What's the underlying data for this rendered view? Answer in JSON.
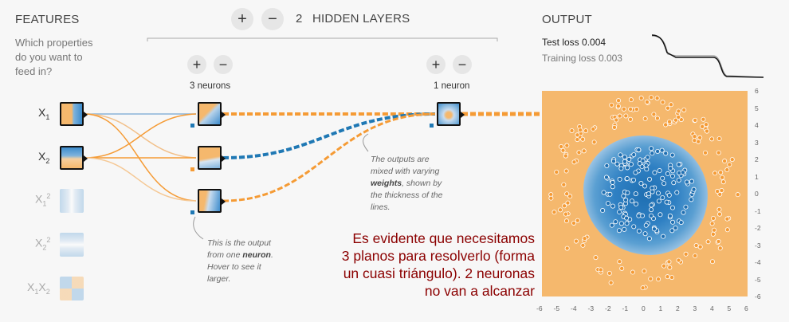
{
  "features": {
    "title": "FEATURES",
    "question": [
      "Which properties",
      "do you want to",
      "feed in?"
    ]
  },
  "hidden": {
    "plus": "+",
    "minus": "−",
    "count": "2",
    "title": "HIDDEN LAYERS",
    "layer1_label": "3 neurons",
    "layer2_label": "1 neuron"
  },
  "output": {
    "title": "OUTPUT",
    "test_loss_label": "Test loss",
    "test_loss_value": "0.004",
    "training_loss_label": "Training loss",
    "training_loss_value": "0.003"
  },
  "notes": {
    "weights_pre": "The outputs are mixed with varying",
    "weights_bold": "weights",
    "weights_post": ", shown by the thickness of the lines.",
    "neuron_pre": "This is the output from one",
    "neuron_bold": "neuron",
    "neuron_post": ". Hover to see it larger."
  },
  "annotation": [
    "Es evidente que necesitamos",
    "3 planos para resolverlo (forma",
    "un cuasi triángulo). 2 neuronas",
    "no van a alcanzar"
  ],
  "axis": {
    "x_ticks": [
      "-6",
      "-5",
      "-4",
      "-3",
      "-2",
      "-1",
      "0",
      "1",
      "2",
      "3",
      "4",
      "5",
      "6"
    ],
    "y_ticks": [
      "6",
      "5",
      "4",
      "3",
      "2",
      "1",
      "0",
      "-1",
      "-2",
      "-3",
      "-4",
      "-5",
      "-6"
    ]
  },
  "colors": {
    "orange": "#f59b35",
    "blue": "#1f78b4",
    "bg_orange": "#f5b86d"
  }
}
